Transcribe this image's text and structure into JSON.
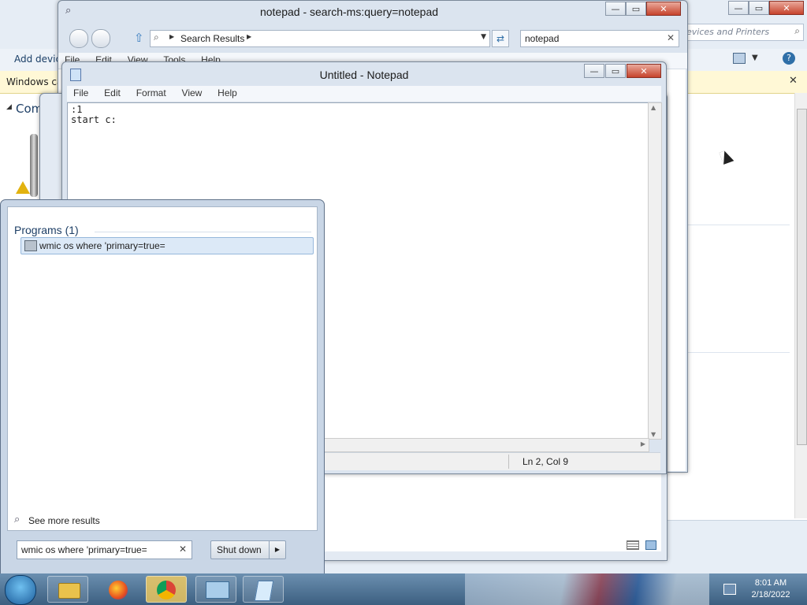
{
  "explorer_back": {
    "breadcrumb": "Add devices",
    "search_text": "evices and Printers",
    "info_bar_text": "Windows ca",
    "section_heading": "Com"
  },
  "explorer_search": {
    "title": "notepad - search-ms:query=notepad",
    "address_label": "Search Results",
    "search_value": "notepad",
    "menu": [
      "File",
      "Edit",
      "View",
      "Tools",
      "Help"
    ]
  },
  "notepad": {
    "title": "Untitled - Notepad",
    "menu": [
      "File",
      "Edit",
      "Format",
      "View",
      "Help"
    ],
    "line1": ":1",
    "line2": "start c:",
    "status": "Ln 2, Col 9"
  },
  "start_menu": {
    "section_title": "Programs (1)",
    "result_item": "wmic os where 'primary=true=",
    "see_more": "See more results",
    "search_value": "wmic os where 'primary=true=",
    "shutdown_label": "Shut down"
  },
  "taskbar": {
    "time": "8:01 AM",
    "date": "2/18/2022",
    "items": [
      "Windows Explorer",
      "Firefox",
      "Chrome",
      "Control Panel",
      "Notepad"
    ]
  },
  "colors": {
    "taskbar": "#4a6d8f",
    "window_frame": "#dbe4ef",
    "selection": "#dce9f7",
    "accent_blue": "#2f6fa8"
  }
}
